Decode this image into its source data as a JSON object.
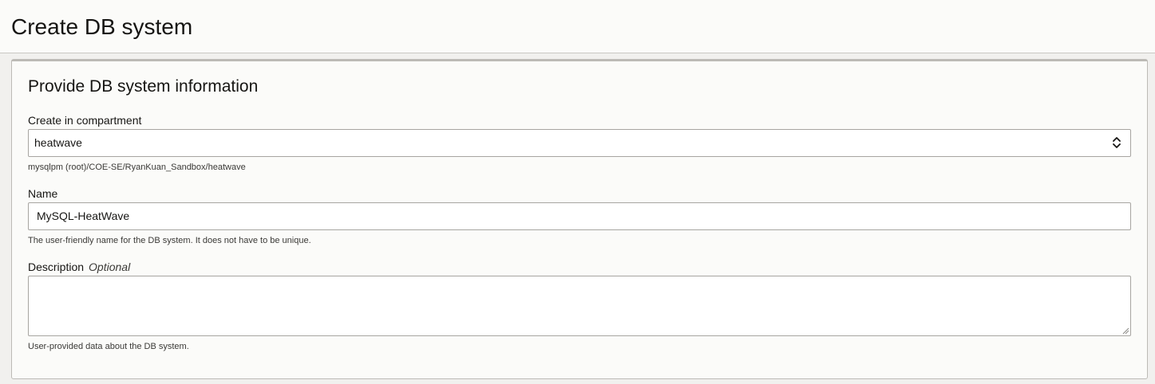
{
  "page": {
    "title": "Create DB system"
  },
  "section": {
    "title": "Provide DB system information"
  },
  "compartment": {
    "label": "Create in compartment",
    "value": "heatwave",
    "path": "mysqlpm (root)/COE-SE/RyanKuan_Sandbox/heatwave"
  },
  "name": {
    "label": "Name",
    "value": "MySQL-HeatWave",
    "help": "The user-friendly name for the DB system. It does not have to be unique."
  },
  "description": {
    "label": "Description",
    "optional": "Optional",
    "value": "",
    "help": "User-provided data about the DB system."
  },
  "icons": {
    "select": "up-down-chevron-icon",
    "resize": "resize-grip-icon"
  }
}
